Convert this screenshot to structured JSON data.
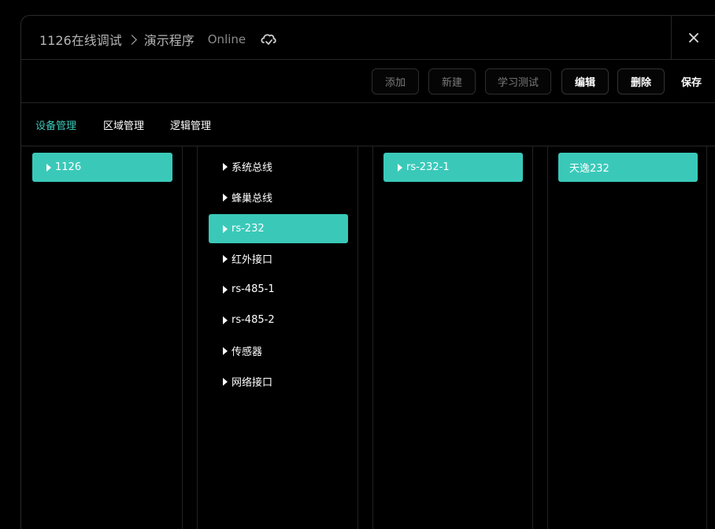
{
  "header": {
    "breadcrumb": [
      "1126在线调试",
      "演示程序"
    ],
    "status": "Online",
    "icons": {
      "status": "cloud-sync-icon",
      "close": "close-icon",
      "separator": "chevron-right-icon"
    }
  },
  "toolbar": {
    "buttons": [
      {
        "label": "添加",
        "state": "disabled"
      },
      {
        "label": "新建",
        "state": "disabled"
      },
      {
        "label": "学习测试",
        "state": "disabled"
      },
      {
        "label": "编辑",
        "state": "enabled"
      },
      {
        "label": "删除",
        "state": "enabled"
      },
      {
        "label": "保存",
        "state": "enabled"
      }
    ]
  },
  "tabs": [
    {
      "label": "设备管理",
      "active": true
    },
    {
      "label": "区域管理",
      "active": false
    },
    {
      "label": "逻辑管理",
      "active": false
    }
  ],
  "columns": {
    "devices": [
      {
        "label": "1126",
        "selected": true,
        "expandable": true
      }
    ],
    "interfaces": [
      {
        "label": "系统总线",
        "selected": false,
        "expandable": true
      },
      {
        "label": "蜂巢总线",
        "selected": false,
        "expandable": true
      },
      {
        "label": "rs-232",
        "selected": true,
        "expandable": true
      },
      {
        "label": "红外接口",
        "selected": false,
        "expandable": true
      },
      {
        "label": "rs-485-1",
        "selected": false,
        "expandable": true
      },
      {
        "label": "rs-485-2",
        "selected": false,
        "expandable": true
      },
      {
        "label": "传感器",
        "selected": false,
        "expandable": true
      },
      {
        "label": "网络接口",
        "selected": false,
        "expandable": true
      }
    ],
    "ports": [
      {
        "label": "rs-232-1",
        "selected": true,
        "expandable": true
      }
    ],
    "items": [
      {
        "label": "天逸232",
        "selected": true,
        "expandable": false
      }
    ]
  },
  "colors": {
    "accent": "#3ac9b9",
    "background": "#000000",
    "border": "#262626",
    "muted": "#7a7a7a"
  }
}
